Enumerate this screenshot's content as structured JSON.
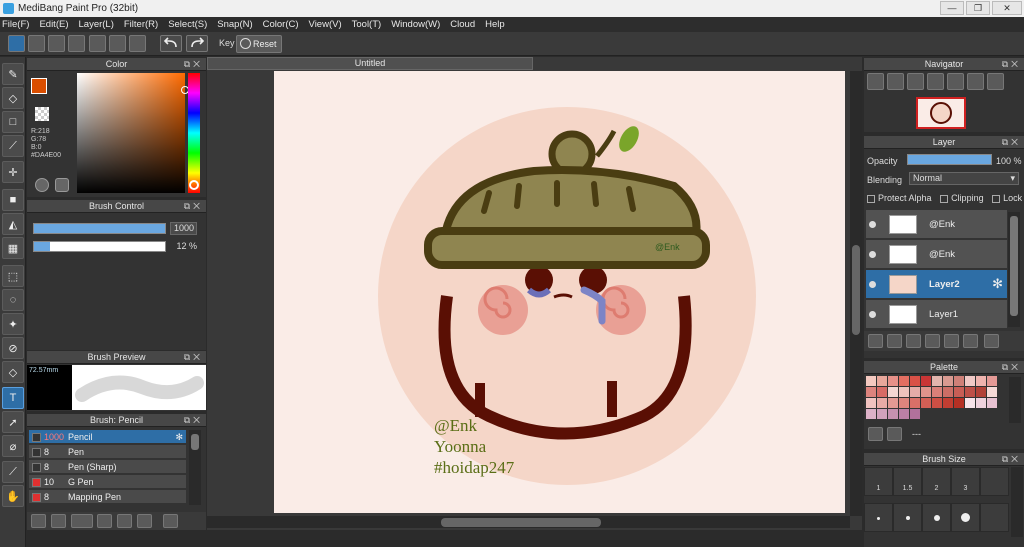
{
  "window": {
    "title": "MediBang Paint Pro (32bit)",
    "min": "—",
    "max": "❐",
    "close": "✕"
  },
  "menu": [
    "File(F)",
    "Edit(E)",
    "Layer(L)",
    "Filter(R)",
    "Select(S)",
    "Snap(N)",
    "Color(C)",
    "View(V)",
    "Tool(T)",
    "Window(W)",
    "Cloud",
    "Help"
  ],
  "toolbar": {
    "key_label": "Key",
    "reset_label": "Reset"
  },
  "color_panel": {
    "title": "Color",
    "r": "R:218",
    "g": "G:78",
    "b": "B:0",
    "hex": "#DA4E00",
    "fg_color": "#DA4E00"
  },
  "brush_control": {
    "title": "Brush Control",
    "size": "1000",
    "opacity": "12 %",
    "size_fill": 1.0,
    "opacity_fill": 0.12
  },
  "brush_preview": {
    "title": "Brush Preview",
    "size": "72.57mm"
  },
  "brush_list": {
    "title": "Brush: Pencil",
    "items": [
      {
        "size": "1000",
        "name": "Pencil",
        "selected": true,
        "color": "#333333"
      },
      {
        "size": "8",
        "name": "Pen",
        "selected": false,
        "color": "#333333"
      },
      {
        "size": "8",
        "name": "Pen (Sharp)",
        "selected": false,
        "color": "#333333"
      },
      {
        "size": "10",
        "name": "G Pen",
        "selected": false,
        "color": "#e03030"
      },
      {
        "size": "8",
        "name": "Mapping Pen",
        "selected": false,
        "color": "#e03030"
      }
    ]
  },
  "document": {
    "tab": "Untitled"
  },
  "artwork": {
    "signature": "@Enk",
    "lines": [
      "@Enk",
      "Yoonna",
      "#hoidap247"
    ],
    "hat_label": "@Enk"
  },
  "navigator": {
    "title": "Navigator"
  },
  "layer_panel": {
    "title": "Layer",
    "opacity_label": "Opacity",
    "opacity_value": "100 %",
    "blending_label": "Blending",
    "blending_value": "Normal",
    "protect_alpha": "Protect Alpha",
    "clipping": "Clipping",
    "lock": "Lock",
    "layers": [
      {
        "name": "@Enk",
        "selected": false
      },
      {
        "name": "@Enk",
        "selected": false
      },
      {
        "name": "Layer2",
        "selected": true
      },
      {
        "name": "Layer1",
        "selected": false
      }
    ]
  },
  "palette": {
    "title": "Palette",
    "extra": "---",
    "colors": [
      "#f4c9c0",
      "#e8a79b",
      "#e79189",
      "#e46f62",
      "#d95147",
      "#c93535",
      "#e2b5ad",
      "#d99a91",
      "#cf8078",
      "#f0c9c6",
      "#efb3ae",
      "#e59a96",
      "#dd837d",
      "#d66b66",
      "#f3d7d3",
      "#eec3bd",
      "#e5aca8",
      "#e0948c",
      "#d98079",
      "#cc6e66",
      "#c85e56",
      "#bd5048",
      "#b14238",
      "#f6dad7",
      "#f2c3c0",
      "#e9aba7",
      "#e39a94",
      "#dd857d",
      "#d97068",
      "#d35f55",
      "#cc4f44",
      "#c23e32",
      "#b53024",
      "#f7e4ea",
      "#efd2dd",
      "#e8c2d2",
      "#ddb2c8",
      "#d2a2bc",
      "#c691b0",
      "#bb80a5",
      "#b1719b"
    ]
  },
  "brush_size": {
    "title": "Brush Size",
    "sizes": [
      "1",
      "1.5",
      "2",
      "3"
    ]
  }
}
